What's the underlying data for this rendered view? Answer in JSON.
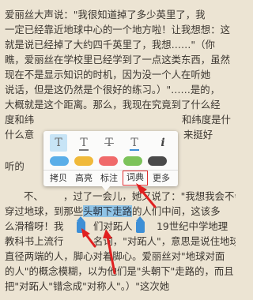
{
  "reader": {
    "lines": [
      "爱丽丝大声说：\"我很知道掉了多少英里了，我",
      "一定已经靠近地球中心的一个地方啦！让我想想：这",
      "就是说已经掉了大约四千英里了，我想……\"（你",
      "瞧，爱丽丝在学校里已经学到了一点这类东西，虽然",
      "现在不是显示知识的时机，因为没一个人在听她",
      "说话，但是这仍然是个很好的练习。）\"……是的，",
      "大概就是这个距离。那么，我现在究竟到了什么经",
      "度和纬",
      "什么意",
      "听的",
      "不、",
      "，"
    ],
    "fragments": {
      "line7_right": "和纬度是什",
      "line8_right": "来挺好",
      "line10_mid": "，过了一会儿，她又说了：\"我想我会不会",
      "line11": "穿过地球，到那些头朝下走路的人们中间，这该多",
      "line11_pre": "穿过地球，到那些",
      "line11_sel": "头朝下走路",
      "line11_post": "的人们中间，这该多",
      "line12_a": "么滑稽呀！我",
      "line12_b": "们对跖人",
      "line12_c": "19世纪中学地理",
      "line13": "教科书上流行",
      "line13_b": "名词，\"对跖人\"，意思是说住地球",
      "line14": "直径两端的人，脚心对着脚心。爱丽丝对\"地球对面",
      "line15": "的人\"的概念模糊，以为他们是\"头朝下\"走路的，而且",
      "line16": "把\"对跖人\"错念成\"对称人\"。）\"这次她"
    }
  },
  "popup": {
    "tools": [
      "T",
      "T",
      "T",
      "T",
      "i"
    ],
    "tool_names": [
      "bold-text",
      "underline-text",
      "strikethrough-text",
      "underline-color-text",
      "info"
    ],
    "swatch_colors": [
      "#5aaee8",
      "#f0b93a",
      "#f06a6a",
      "#7cc35a",
      "#4a4a4a"
    ],
    "buttons": [
      "拷贝",
      "高亮",
      "标注",
      "词典",
      "更多"
    ],
    "selected_button": "词典"
  },
  "colors": {
    "page_background": "#ece4d3",
    "selection": "#8fc3e6",
    "handle": "#3d8fd6",
    "annotation_arrow": "#e02020"
  }
}
